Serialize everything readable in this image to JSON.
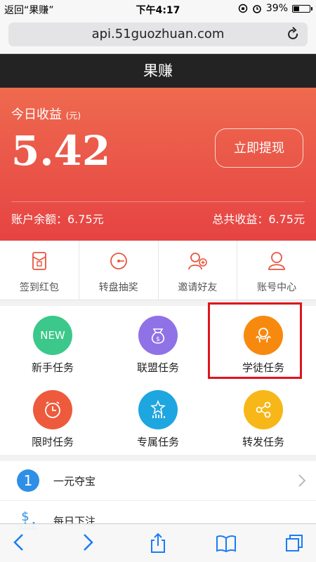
{
  "status_bar": {
    "back_app": "返回“果赚”",
    "time": "下午4:17",
    "battery": "39%",
    "battery_level": 0.39
  },
  "browser": {
    "url": "api.51guozhuan.com"
  },
  "header": {
    "title": "果赚"
  },
  "earnings": {
    "today_label": "今日收益",
    "unit": "(元)",
    "amount": "5.42",
    "withdraw_label": "立即提现",
    "balance": "账户余额：6.75元",
    "total": "总共收益：6.75元"
  },
  "shortcuts": [
    {
      "label": "签到红包",
      "icon": "red-envelope-icon"
    },
    {
      "label": "转盘抽奖",
      "icon": "wheel-icon"
    },
    {
      "label": "邀请好友",
      "icon": "invite-user-icon"
    },
    {
      "label": "账号中心",
      "icon": "account-icon"
    }
  ],
  "tasks": [
    {
      "label": "新手任务",
      "icon": "new-badge-icon",
      "icon_text": "NEW",
      "color": "#3cc88a"
    },
    {
      "label": "联盟任务",
      "icon": "money-bag-icon",
      "color": "#8f72e6"
    },
    {
      "label": "学徒任务",
      "icon": "apprentice-icon",
      "color": "#f7890f"
    },
    {
      "label": "限时任务",
      "icon": "alarm-clock-icon",
      "color": "#ee5a3c"
    },
    {
      "label": "专属任务",
      "icon": "star-chart-icon",
      "color": "#1ea6e0"
    },
    {
      "label": "转发任务",
      "icon": "share-icon",
      "color": "#f7b718"
    }
  ],
  "list": [
    {
      "label": "一元夺宝",
      "icon": "number-one-icon",
      "icon_text": "1"
    },
    {
      "label": "每日下注",
      "icon": "dollar-chart-icon"
    }
  ],
  "colors": {
    "accent_red": "#e64343",
    "highlight_box": "#e0141e",
    "ios_blue": "#1a7cf5"
  }
}
